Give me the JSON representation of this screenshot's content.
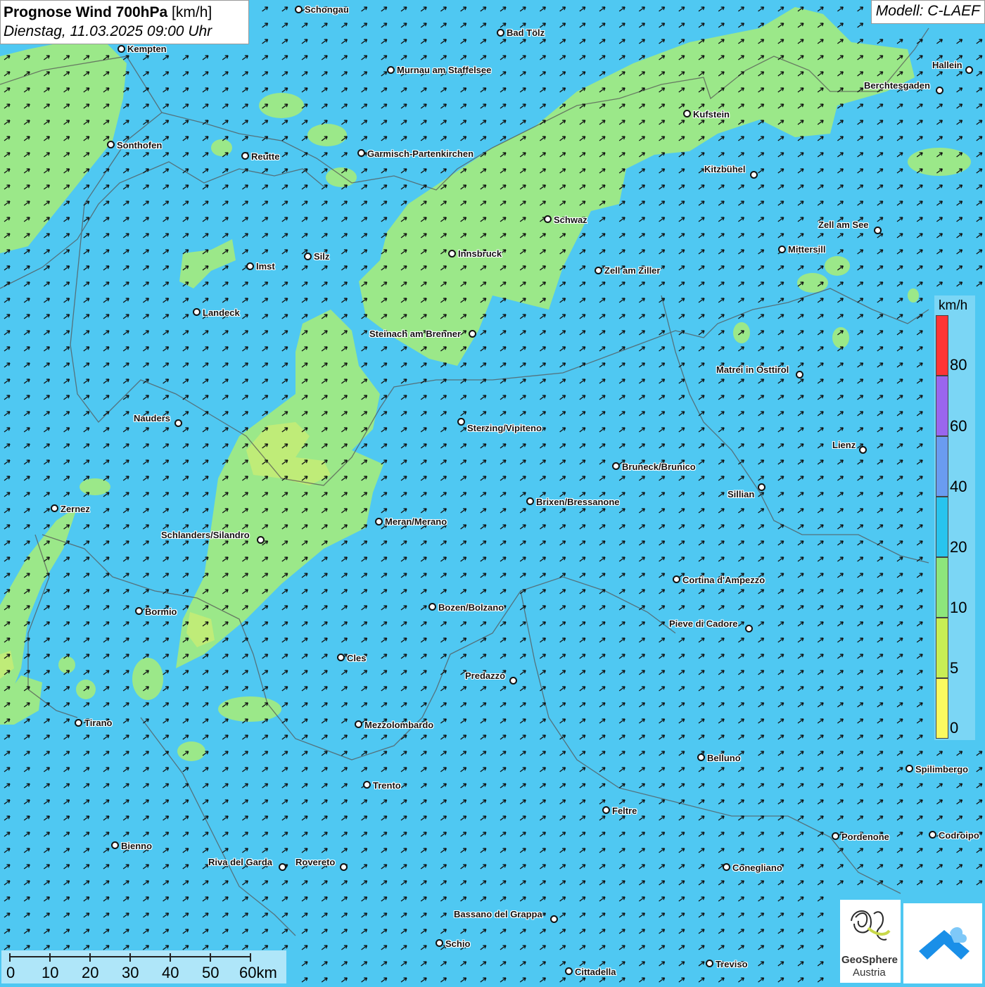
{
  "title": {
    "bold": "Prognose Wind 700hPa",
    "unit": "[km/h]",
    "datetime": "Dienstag, 11.03.2025 09:00 Uhr"
  },
  "model": "Modell: C-LAEF",
  "colors": {
    "background_wind": "#4fc8f2",
    "light_wind": "#9be889",
    "yellow_green": "#cfee70",
    "arrow": "#111111"
  },
  "wind_arrows": {
    "direction": "south-west to north-east"
  },
  "legend": {
    "unit": "km/h",
    "labels": [
      "80",
      "60",
      "40",
      "20",
      "10",
      "5",
      "0"
    ],
    "segments": [
      {
        "color": "#ff3535"
      },
      {
        "color": "#9a66ee"
      },
      {
        "color": "#6a9cf0"
      },
      {
        "color": "#28c4ee"
      },
      {
        "color": "#8de67c"
      },
      {
        "color": "#c8ee55"
      },
      {
        "color": "#fafa60"
      }
    ]
  },
  "scale": {
    "labels": [
      "0",
      "10",
      "20",
      "30",
      "40",
      "50",
      "60km"
    ]
  },
  "logo": {
    "line1": "GeoSphere",
    "line2": "Austria"
  },
  "cities": [
    {
      "name": "Schongau"
    },
    {
      "name": "Bad Tölz"
    },
    {
      "name": "Kempten"
    },
    {
      "name": "Murnau am Staffelsee"
    },
    {
      "name": "Hallein"
    },
    {
      "name": "Berchtesgaden"
    },
    {
      "name": "Kufstein"
    },
    {
      "name": "Sonthofen"
    },
    {
      "name": "Reutte"
    },
    {
      "name": "Garmisch-Partenkirchen"
    },
    {
      "name": "Kitzbühel"
    },
    {
      "name": "Schwaz"
    },
    {
      "name": "Zell am See"
    },
    {
      "name": "Mittersill"
    },
    {
      "name": "Innsbruck"
    },
    {
      "name": "Silz"
    },
    {
      "name": "Imst"
    },
    {
      "name": "Zell am Ziller"
    },
    {
      "name": "Landeck"
    },
    {
      "name": "Steinach am Brenner"
    },
    {
      "name": "Matrei in Osttirol"
    },
    {
      "name": "Nauders"
    },
    {
      "name": "Sterzing/Vipiteno"
    },
    {
      "name": "Lienz"
    },
    {
      "name": "Bruneck/Brunico"
    },
    {
      "name": "Sillian"
    },
    {
      "name": "Brixen/Bressanone"
    },
    {
      "name": "Zernez"
    },
    {
      "name": "Meran/Merano"
    },
    {
      "name": "Schlanders/Silandro"
    },
    {
      "name": "Cortina d'Ampezzo"
    },
    {
      "name": "Bozen/Bolzano"
    },
    {
      "name": "Bormio"
    },
    {
      "name": "Pieve di Cadore"
    },
    {
      "name": "Cles"
    },
    {
      "name": "Predazzo"
    },
    {
      "name": "Tirano"
    },
    {
      "name": "Mezzolombardo"
    },
    {
      "name": "Belluno"
    },
    {
      "name": "Spilimbergo"
    },
    {
      "name": "Trento"
    },
    {
      "name": "Feltre"
    },
    {
      "name": "Pordenone"
    },
    {
      "name": "Codroipo"
    },
    {
      "name": "Bienno"
    },
    {
      "name": "Riva del Garda"
    },
    {
      "name": "Rovereto"
    },
    {
      "name": "Conegliano"
    },
    {
      "name": "Bassano del Grappa"
    },
    {
      "name": "Schio"
    },
    {
      "name": "Treviso"
    },
    {
      "name": "Cittadella"
    }
  ]
}
